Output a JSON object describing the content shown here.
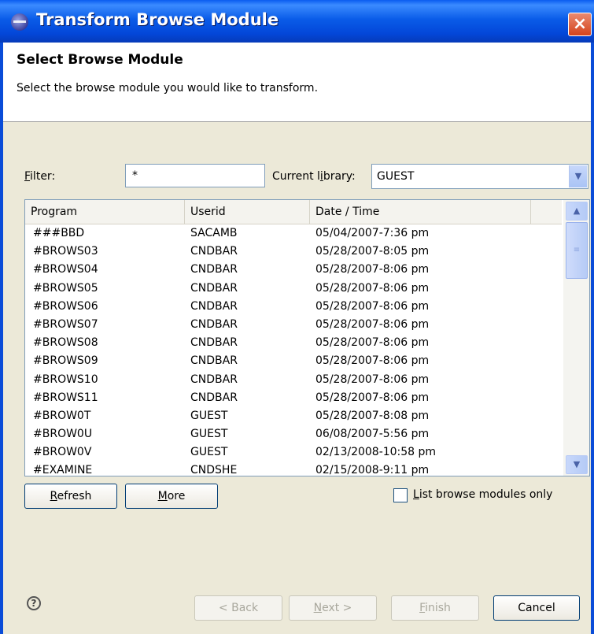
{
  "window": {
    "title": "Transform Browse Module",
    "close_label": "×"
  },
  "header": {
    "title": "Select Browse Module",
    "description": "Select the browse module you would like to transform."
  },
  "filter": {
    "label_prefix": "F",
    "label_rest": "ilter:",
    "value": "*"
  },
  "library": {
    "label_pre": "Current l",
    "label_u": "i",
    "label_post": "brary:",
    "value": "GUEST"
  },
  "table": {
    "headers": [
      "Program",
      "Userid",
      "Date / Time"
    ],
    "rows": [
      [
        "###BBD",
        "SACAMB",
        "05/04/2007-7:36 pm"
      ],
      [
        "#BROWS03",
        "CNDBAR",
        "05/28/2007-8:05 pm"
      ],
      [
        "#BROWS04",
        "CNDBAR",
        "05/28/2007-8:06 pm"
      ],
      [
        "#BROWS05",
        "CNDBAR",
        "05/28/2007-8:06 pm"
      ],
      [
        "#BROWS06",
        "CNDBAR",
        "05/28/2007-8:06 pm"
      ],
      [
        "#BROWS07",
        "CNDBAR",
        "05/28/2007-8:06 pm"
      ],
      [
        "#BROWS08",
        "CNDBAR",
        "05/28/2007-8:06 pm"
      ],
      [
        "#BROWS09",
        "CNDBAR",
        "05/28/2007-8:06 pm"
      ],
      [
        "#BROWS10",
        "CNDBAR",
        "05/28/2007-8:06 pm"
      ],
      [
        "#BROWS11",
        "CNDBAR",
        "05/28/2007-8:06 pm"
      ],
      [
        "#BROW0T",
        "GUEST",
        "05/28/2007-8:08 pm"
      ],
      [
        "#BROW0U",
        "GUEST",
        "06/08/2007-5:56 pm"
      ],
      [
        "#BROW0V",
        "GUEST",
        "02/13/2008-10:58 pm"
      ],
      [
        "#EXAMINE",
        "CNDSHE",
        "02/15/2008-9:11 pm"
      ]
    ]
  },
  "buttons": {
    "refresh_u": "R",
    "refresh_rest": "efresh",
    "more_u": "M",
    "more_rest": "ore",
    "back": "< Back",
    "back_u": "B",
    "next_u": "N",
    "next_rest": "ext >",
    "finish_u": "F",
    "finish_rest": "inish",
    "cancel": "Cancel"
  },
  "checkbox": {
    "label_u": "L",
    "label_rest": "ist browse modules only",
    "checked": false
  },
  "help": {
    "symbol": "?"
  }
}
